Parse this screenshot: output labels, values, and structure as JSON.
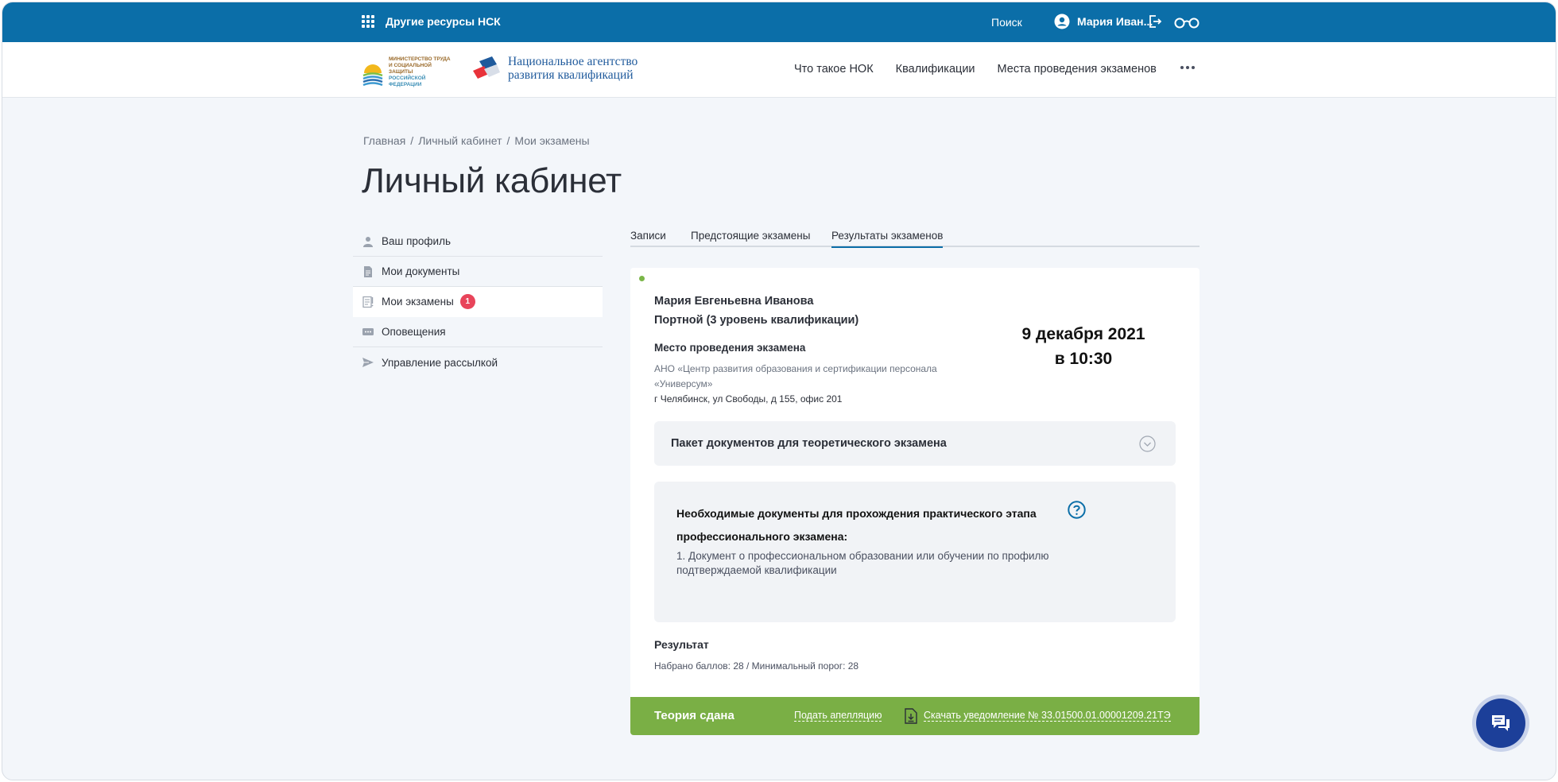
{
  "topbar": {
    "resources_label": "Другие ресурсы НСК",
    "search_label": "Поиск",
    "user_name": "Мария Иван..."
  },
  "header": {
    "ministry_line1": "МИНИСТЕРСТВО ТРУДА",
    "ministry_line2": "И СОЦИАЛЬНОЙ ЗАЩИТЫ",
    "ministry_line3": "РОССИЙСКОЙ ФЕДЕРАЦИИ",
    "agency_line1": "Национальное агентство",
    "agency_line2": "развития квалификаций",
    "nav": [
      "Что такое НОК",
      "Квалификации",
      "Места проведения экзаменов"
    ]
  },
  "breadcrumb": [
    "Главная",
    "Личный кабинет",
    "Мои экзамены"
  ],
  "breadcrumb_separator": "/",
  "page_title": "Личный кабинет",
  "sidebar": {
    "items": [
      {
        "label": "Ваш профиль",
        "icon": "user-icon"
      },
      {
        "label": "Мои документы",
        "icon": "document-icon"
      },
      {
        "label": "Мои экзамены",
        "icon": "exam-icon",
        "badge": "1",
        "active": true
      },
      {
        "label": "Оповещения",
        "icon": "message-icon"
      },
      {
        "label": "Управление рассылкой",
        "icon": "send-icon"
      }
    ]
  },
  "tabs": [
    "Записи",
    "Предстоящие экзамены",
    "Результаты экзаменов"
  ],
  "active_tab": "Результаты экзаменов",
  "exam": {
    "person_name": "Мария Евгеньевна Иванова",
    "qualification": "Портной (3 уровень квалификации)",
    "date": "9 декабря 2021",
    "time": "в 10:30",
    "place_label": "Место проведения экзамена",
    "place_org": "АНО «Центр развития образования и сертификации персонала «Универсум»",
    "place_address": "г Челябинск, ул Свободы, д 155, офис 201",
    "docs_package_title": "Пакет документов для теоретического экзамена",
    "required_docs_title": "Необходимые документы для прохождения практического этапа профессионального экзамена:",
    "required_docs_item": "1. Документ о профессиональном образовании или обучении по профилю подтверждаемой квалификации",
    "result_label": "Результат",
    "result_value": "Набрано баллов: 28 / Минимальный порог: 28",
    "verdict": "Теория сдана",
    "appeal_link": "Подать апелляцию",
    "download_link": "Скачать уведомление № 33.01500.01.00001209.21ТЭ"
  },
  "colors": {
    "topbar": "#0b6ea8",
    "success": "#7aaf45",
    "badge": "#e8445a",
    "chat": "#1c3f99"
  }
}
